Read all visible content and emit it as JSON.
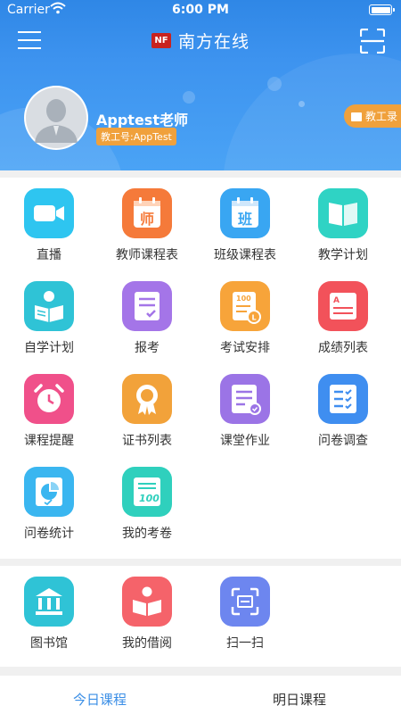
{
  "status_bar": {
    "carrier": "Carrier",
    "time": "6:00 PM"
  },
  "nav": {
    "logo_text": "NF",
    "title": "南方在线"
  },
  "profile": {
    "name": "Apptest老师",
    "id_badge": "教工号:AppTest",
    "directory_button": "教工录"
  },
  "apps": [
    {
      "label": "直播",
      "icon": "video-camera-icon",
      "color": "#2ec5f0"
    },
    {
      "label": "教师课程表",
      "icon": "teacher-calendar-icon",
      "color": "#f57a3a",
      "glyph": "师"
    },
    {
      "label": "班级课程表",
      "icon": "class-calendar-icon",
      "color": "#39a6f2",
      "glyph": "班"
    },
    {
      "label": "教学计划",
      "icon": "open-book-icon",
      "color": "#2fd3c4"
    },
    {
      "label": "自学计划",
      "icon": "self-study-icon",
      "color": "#2fc3d6"
    },
    {
      "label": "报考",
      "icon": "register-form-icon",
      "color": "#a475e8"
    },
    {
      "label": "考试安排",
      "icon": "exam-schedule-icon",
      "color": "#f7a43a"
    },
    {
      "label": "成绩列表",
      "icon": "grade-list-icon",
      "color": "#f2525a"
    },
    {
      "label": "课程提醒",
      "icon": "alarm-clock-icon",
      "color": "#f0508a"
    },
    {
      "label": "证书列表",
      "icon": "certificate-icon",
      "color": "#f2a23a"
    },
    {
      "label": "课堂作业",
      "icon": "homework-icon",
      "color": "#9b74e6"
    },
    {
      "label": "问卷调查",
      "icon": "survey-checklist-icon",
      "color": "#3f8ef0"
    },
    {
      "label": "问卷统计",
      "icon": "survey-stats-icon",
      "color": "#3ab6f0"
    },
    {
      "label": "我的考卷",
      "icon": "exam-paper-icon",
      "color": "#2fd0bd"
    }
  ],
  "services": [
    {
      "label": "图书馆",
      "icon": "library-icon",
      "color": "#2fc3d6"
    },
    {
      "label": "我的借阅",
      "icon": "borrowed-book-icon",
      "color": "#f5636a"
    },
    {
      "label": "扫一扫",
      "icon": "scan-icon",
      "color": "#6d86ef"
    }
  ],
  "tabs": {
    "today": "今日课程",
    "tomorrow": "明日课程"
  },
  "colors": {
    "header_blue": "#3a8ee6",
    "accent_orange": "#f0a13c",
    "active_tab": "#3a8ee6"
  }
}
